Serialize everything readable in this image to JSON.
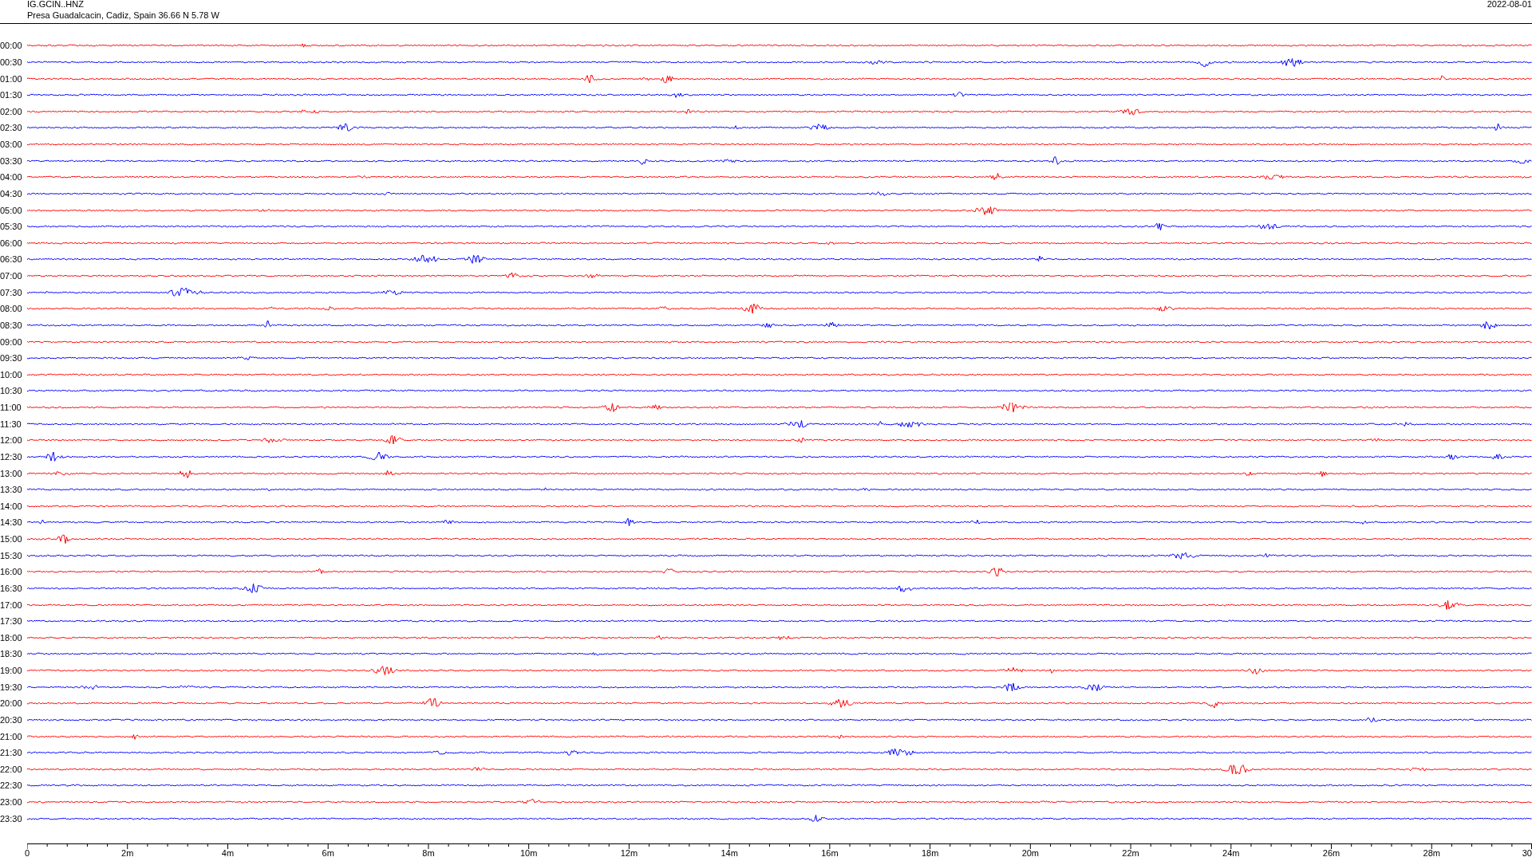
{
  "header": {
    "station": "IG.GCIN..HNZ",
    "location": "Presa Guadalcacin, Cadiz, Spain  36.66 N 5.78 W",
    "date": "2022-08-01"
  },
  "rows": [
    {
      "time": "00:00",
      "color": "#ff0000"
    },
    {
      "time": "00:30",
      "color": "#0000ff"
    },
    {
      "time": "01:00",
      "color": "#ff0000"
    },
    {
      "time": "01:30",
      "color": "#0000ff"
    },
    {
      "time": "02:00",
      "color": "#ff0000"
    },
    {
      "time": "02:30",
      "color": "#0000ff"
    },
    {
      "time": "03:00",
      "color": "#ff0000"
    },
    {
      "time": "03:30",
      "color": "#0000ff"
    },
    {
      "time": "04:00",
      "color": "#ff0000"
    },
    {
      "time": "04:30",
      "color": "#0000ff"
    },
    {
      "time": "05:00",
      "color": "#ff0000"
    },
    {
      "time": "05:30",
      "color": "#0000ff"
    },
    {
      "time": "06:00",
      "color": "#ff0000"
    },
    {
      "time": "06:30",
      "color": "#0000ff"
    },
    {
      "time": "07:00",
      "color": "#ff0000"
    },
    {
      "time": "07:30",
      "color": "#0000ff"
    },
    {
      "time": "08:00",
      "color": "#ff0000"
    },
    {
      "time": "08:30",
      "color": "#0000ff"
    },
    {
      "time": "09:00",
      "color": "#ff0000"
    },
    {
      "time": "09:30",
      "color": "#0000ff"
    },
    {
      "time": "10:00",
      "color": "#ff0000"
    },
    {
      "time": "10:30",
      "color": "#0000ff"
    },
    {
      "time": "11:00",
      "color": "#ff0000"
    },
    {
      "time": "11:30",
      "color": "#0000ff"
    },
    {
      "time": "12:00",
      "color": "#ff0000"
    },
    {
      "time": "12:30",
      "color": "#0000ff"
    },
    {
      "time": "13:00",
      "color": "#ff0000"
    },
    {
      "time": "13:30",
      "color": "#0000ff"
    },
    {
      "time": "14:00",
      "color": "#ff0000"
    },
    {
      "time": "14:30",
      "color": "#0000ff"
    },
    {
      "time": "15:00",
      "color": "#ff0000"
    },
    {
      "time": "15:30",
      "color": "#0000ff"
    },
    {
      "time": "16:00",
      "color": "#ff0000"
    },
    {
      "time": "16:30",
      "color": "#0000ff"
    },
    {
      "time": "17:00",
      "color": "#ff0000"
    },
    {
      "time": "17:30",
      "color": "#0000ff"
    },
    {
      "time": "18:00",
      "color": "#ff0000"
    },
    {
      "time": "18:30",
      "color": "#0000ff"
    },
    {
      "time": "19:00",
      "color": "#ff0000"
    },
    {
      "time": "19:30",
      "color": "#0000ff"
    },
    {
      "time": "20:00",
      "color": "#ff0000"
    },
    {
      "time": "20:30",
      "color": "#0000ff"
    },
    {
      "time": "21:00",
      "color": "#ff0000"
    },
    {
      "time": "21:30",
      "color": "#0000ff"
    },
    {
      "time": "22:00",
      "color": "#ff0000"
    },
    {
      "time": "22:30",
      "color": "#0000ff"
    },
    {
      "time": "23:00",
      "color": "#ff0000"
    },
    {
      "time": "23:30",
      "color": "#0000ff"
    }
  ],
  "x_axis": {
    "labels": [
      "0",
      "2m",
      "4m",
      "6m",
      "8m",
      "10m",
      "12m",
      "14m",
      "16m",
      "18m",
      "20m",
      "22m",
      "24m",
      "26m",
      "28m",
      "30"
    ]
  }
}
